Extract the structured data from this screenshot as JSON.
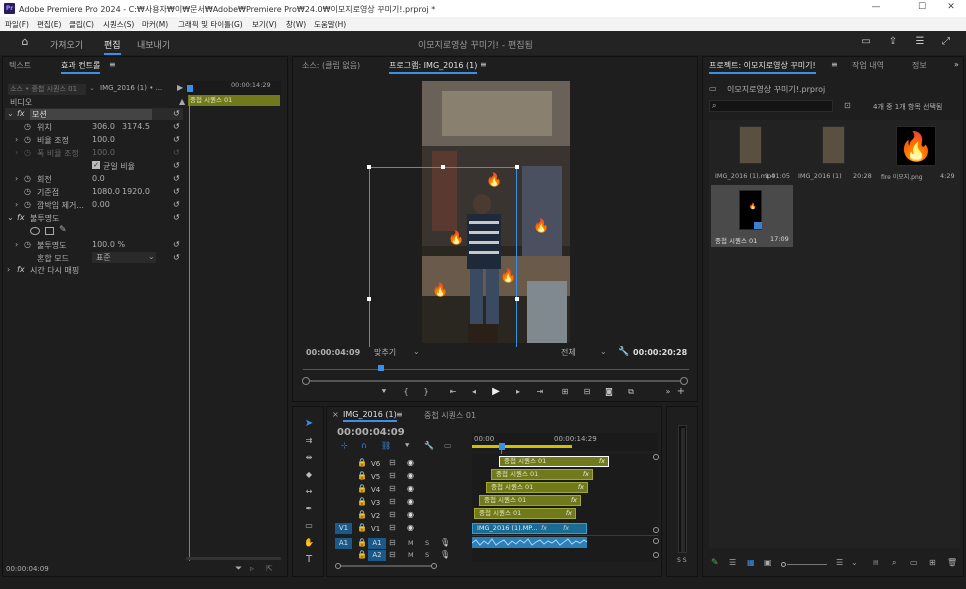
{
  "window": {
    "app_badge": "Pr",
    "title": "Adobe Premiere Pro 2024 - C:₩사용자₩이₩문서₩Adobe₩Premiere Pro₩24.0₩이모지로영상 꾸미기!.prproj *",
    "minimize": "—",
    "maximize": "☐",
    "close": "✕"
  },
  "menu": [
    "파일(F)",
    "편집(E)",
    "클립(C)",
    "시퀀스(S)",
    "마커(M)",
    "그래픽 및 타이틀(G)",
    "보기(V)",
    "창(W)",
    "도움말(H)"
  ],
  "workspace": {
    "tabs": [
      "가져오기",
      "편집",
      "내보내기"
    ],
    "active": "편집",
    "project_title": "이모지로영상 꾸미기! - 편집됨"
  },
  "effect_controls": {
    "tabs": [
      "텍스트",
      "효과 컨트롤",
      "≡"
    ],
    "source_label": "소스 • 중첩 시퀀스 01",
    "clip_label": "IMG_2016 (1) • ...",
    "timecode_ruler": "00:00:14:29",
    "clip_bar": "중첩 시퀀스 01",
    "video_header": "비디오",
    "motion": "모션",
    "position_label": "위치",
    "position_x": "306.0",
    "position_y": "3174.5",
    "scale_label": "비율 조정",
    "scale": "100.0",
    "scale_width_label": "폭 비율 조정",
    "scale_width": "100.0",
    "uniform_scale": "균일 비율",
    "rotation_label": "회전",
    "rotation": "0.0",
    "anchor_label": "기준점",
    "anchor_x": "1080.0",
    "anchor_y": "1920.0",
    "flicker_label": "깜박임 제거...",
    "flicker": "0.00",
    "opacity_header": "불투명도",
    "opacity_label": "불투명도",
    "opacity": "100.0 %",
    "blend_label": "혼합 모드",
    "blend": "표준",
    "time_remap": "시간 다시 매핑",
    "footer_timecode": "00:00:04:09"
  },
  "program_monitor": {
    "source_tab": "소스: (클립 없음)",
    "program_tab": "프로그램: IMG_2016 (1)",
    "menu_icon": "≡",
    "timecode": "00:00:04:09",
    "fit": "맞추기",
    "quality": "전체",
    "duration": "00:00:20:28"
  },
  "project": {
    "tabs": [
      "프로젝트: 이모지로영상 꾸미기!",
      "≡",
      "작업 내역",
      "정보",
      "»"
    ],
    "file": "이모지로영상 꾸미기!.prproj",
    "selection_info": "4개 중 1개 항목 선택됨",
    "items": [
      {
        "name": "IMG_2016 (1).mp4",
        "duration": "1:01:05"
      },
      {
        "name": "IMG_2016 (1)",
        "duration": "20:28"
      },
      {
        "name": "fire 이모지.png",
        "duration": "4:29"
      },
      {
        "name": "중첩 시퀀스 01",
        "duration": "17:09"
      }
    ]
  },
  "timeline": {
    "tabs": [
      "×",
      "IMG_2016 (1)",
      "≡",
      "중첩 시퀀스 01"
    ],
    "timecode": "00:00:04:09",
    "ruler": [
      "00:00",
      "00:00:14:29"
    ],
    "video_tracks": [
      "V6",
      "V5",
      "V4",
      "V3",
      "V2",
      "V1"
    ],
    "audio_tracks": [
      "A1",
      "A2"
    ],
    "source_patch_v": "V1",
    "source_patch_a": "A1",
    "clips": [
      {
        "track": "V6",
        "name": "중첩 시퀀스 01"
      },
      {
        "track": "V5",
        "name": "중첩 시퀀스 01"
      },
      {
        "track": "V4",
        "name": "중첩 시퀀스 01"
      },
      {
        "track": "V3",
        "name": "중첩 시퀀스 01"
      },
      {
        "track": "V2",
        "name": "중첩 시퀀스 01"
      },
      {
        "track": "V1",
        "name": "IMG_2016 (1).MP..."
      }
    ],
    "fx_badge": "fx",
    "meter_label": "S S"
  },
  "colors": {
    "accent": "#3a8fe8",
    "clip_nested": "#707a1d",
    "clip_video": "#1a6c94",
    "audio": "#2d7fb8"
  }
}
